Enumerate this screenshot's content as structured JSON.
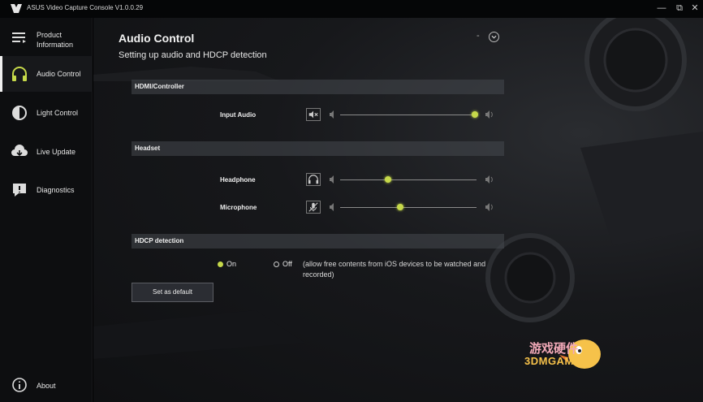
{
  "window": {
    "title": "ASUS Video Capture Console V1.0.0.29",
    "controls": {
      "minimize": "—",
      "restore": "⧉",
      "close": "✕"
    }
  },
  "sidebar": {
    "items": [
      {
        "label": "Product Information",
        "icon": "list-icon"
      },
      {
        "label": "Audio Control",
        "icon": "headphones-icon",
        "active": true
      },
      {
        "label": "Light Control",
        "icon": "lighting-icon"
      },
      {
        "label": "Live Update",
        "icon": "cloud-download-icon"
      },
      {
        "label": "Diagnostics",
        "icon": "alert-icon"
      }
    ],
    "about": {
      "label": "About",
      "icon": "info-icon"
    }
  },
  "main": {
    "title": "Audio Control",
    "subtitle": "Setting up audio and HDCP detection",
    "minimize": "-",
    "sections": {
      "hdmi": {
        "label": "HDMI/Controller",
        "rows": [
          {
            "label": "Input Audio",
            "icon": "speaker-muted-icon",
            "value": 0.99
          }
        ]
      },
      "headset": {
        "label": "Headset",
        "rows": [
          {
            "label": "Headphone",
            "icon": "headset-icon",
            "value": 0.35
          },
          {
            "label": "Microphone",
            "icon": "microphone-muted-icon",
            "value": 0.44
          }
        ]
      },
      "hdcp": {
        "label": "HDCP detection",
        "on_label": "On",
        "off_label": "Off",
        "selected": "On",
        "note": "(allow free contents from iOS devices to be watched and recorded)"
      }
    },
    "set_default_label": "Set as default"
  },
  "watermark": {
    "cn": "游戏硬件",
    "en": "3DMGAME"
  },
  "colors": {
    "accent": "#c6d94a",
    "background": "#0d0e10",
    "section_bar": "#46484e"
  }
}
